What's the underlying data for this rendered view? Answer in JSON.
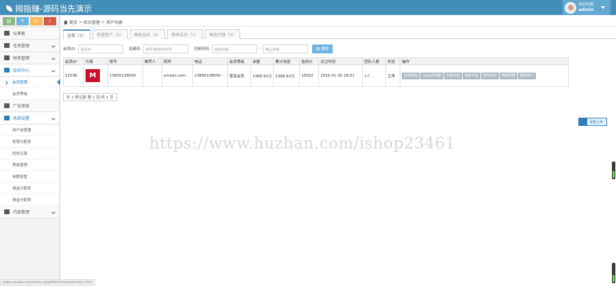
{
  "app": {
    "title": "拇指赚-源码当先演示"
  },
  "user": {
    "greeting": "欢迎光临,",
    "name": "admin"
  },
  "shortcuts": [
    {
      "icon": "chart-icon",
      "label": "▤"
    },
    {
      "icon": "pencil-icon",
      "label": "✎"
    },
    {
      "icon": "users-icon",
      "label": "☺"
    },
    {
      "icon": "bell-icon",
      "label": "♪"
    }
  ],
  "sidebar": {
    "items": [
      {
        "label": "仪表板"
      },
      {
        "label": "任务管理"
      },
      {
        "label": "财务管理"
      },
      {
        "label": "会员中心"
      },
      {
        "label": "广告审核"
      },
      {
        "label": "系统设置"
      },
      {
        "label": "内容管理"
      }
    ],
    "member_sub": [
      {
        "label": "会员管理"
      },
      {
        "label": "会员等级"
      }
    ],
    "system_sub": [
      {
        "label": "用户组管理"
      },
      {
        "label": "权限分配表"
      },
      {
        "label": "短信记录"
      },
      {
        "label": "等级管理"
      },
      {
        "label": "参数配置"
      },
      {
        "label": "佣金分配表"
      },
      {
        "label": "佣金分配表"
      }
    ]
  },
  "breadcrumb": {
    "home": "首页",
    "section": "后台管理",
    "page": "用户列表"
  },
  "tabs": [
    {
      "label": "全部（1）"
    },
    {
      "label": "普通用户（0）"
    },
    {
      "label": "高级会员（0）"
    },
    {
      "label": "尊享会员（1）"
    },
    {
      "label": "高级代理（0）"
    }
  ],
  "filters": {
    "member_id_label": "会员ID:",
    "member_id_placeholder": "会员ID",
    "keyword_label": "关键词:",
    "keyword_placeholder": "账号/昵称/手机号",
    "time_label": "注册时间:",
    "start_placeholder": "起始日期",
    "separator": "-",
    "end_placeholder": "截止日期",
    "search_label": "搜索"
  },
  "table": {
    "headers": [
      "会员ID",
      "头像",
      "账号",
      "推荐人",
      "昵称",
      "电话",
      "会员等级",
      "余额",
      "累计充值",
      "信用分",
      "关注时间",
      "团队人数",
      "状态",
      "操作"
    ],
    "rows": [
      {
        "id": "51538",
        "avatar_text": "M",
        "account": "13800138000",
        "referrer": "",
        "nickname": "ymadx.com",
        "phone": "13800138000",
        "level": "尊享会员",
        "balance": "2388.92元",
        "recharge": "2388.92元",
        "credit": "10302",
        "time": "2020-01-30 18:01",
        "team": "0人",
        "status": "正常",
        "ops": [
          "变更等级",
          "vip会员到期",
          "余额充值",
          "佣金充值",
          "修改资料",
          "佣金明细",
          "删除用户"
        ]
      }
    ]
  },
  "pager": {
    "text": "共 1 条记录 第 1 页/共 1 页"
  },
  "watermark": "https://www.huzhan.com/ishop23461",
  "upload": {
    "label": "百度上传"
  },
  "statusbar": {
    "url": "www.ymadx.com/index.php/Admin/Users/index.html"
  }
}
